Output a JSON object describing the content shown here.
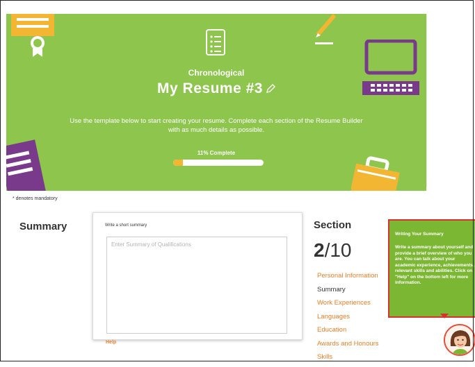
{
  "hero": {
    "template_type": "Chronological",
    "title": "My Resume #3",
    "description": "Use the template below to start creating your resume. Complete each section of the Resume Builder with as much details as possible.",
    "progress_label": "11% Complete",
    "progress_fraction": 0.11,
    "background_color": "#8dc54d"
  },
  "mandatory_note": "* denotes mandatory",
  "summary": {
    "heading": "Summary",
    "field_label": "Write a short summary",
    "placeholder": "Enter Summary of Qualifications",
    "help_label": "Help"
  },
  "section": {
    "heading": "Section",
    "current": "2",
    "total": "/10",
    "items": [
      {
        "label": "Personal Information",
        "active": false
      },
      {
        "label": "Summary",
        "active": true
      },
      {
        "label": "Work Experiences",
        "active": false
      },
      {
        "label": "Languages",
        "active": false
      },
      {
        "label": "Education",
        "active": false
      },
      {
        "label": "Awards and Honours",
        "active": false
      },
      {
        "label": "Skills",
        "active": false
      }
    ]
  },
  "tooltip": {
    "title": "Writing Your Summary",
    "body": "Write a summary about yourself and provide a brief overview of who you are. You can talk about your academic experience, achievements, relevant skills and abilities. Click on \"Help\" on the bottom left for more information.",
    "close_label": "×"
  },
  "icons": {
    "template_doc": "document-list-icon",
    "edit": "pencil-icon",
    "certificate": "certificate-icon",
    "laptop": "laptop-icon",
    "briefcase": "briefcase-icon",
    "documents": "documents-icon",
    "assistant": "assistant-avatar-icon"
  },
  "colors": {
    "accent_orange": "#e87f2a",
    "progress_yellow": "#f2b632",
    "tooltip_border": "#d93030",
    "laptop_purple": "#7a3a8c"
  }
}
